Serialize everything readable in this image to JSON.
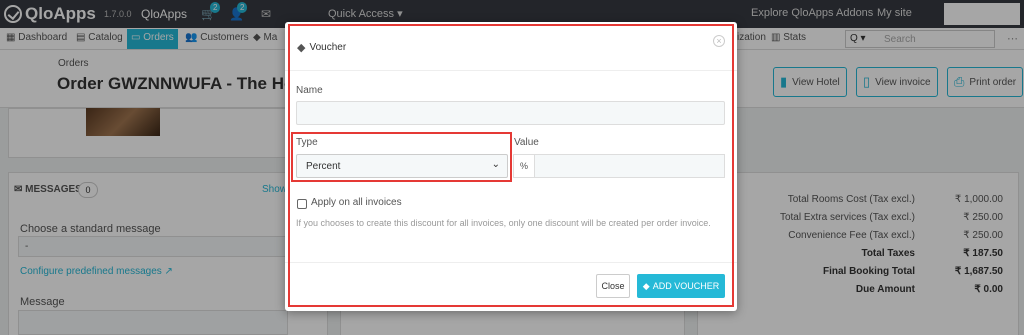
{
  "topbar": {
    "logo_text": "QloApps",
    "version": "1.7.0.0",
    "shop_name": "QloApps",
    "cart_badge": "2",
    "user_badge": "2",
    "quick_access": "Quick Access ▾",
    "explore": "Explore QloApps Addons",
    "my_site": "My site"
  },
  "nav": {
    "items": [
      "Dashboard",
      "Catalog",
      "Orders",
      "Customers",
      "Ma",
      "ization",
      "Stats"
    ],
    "search_scope": "Q ▾",
    "search_placeholder": "Search"
  },
  "header": {
    "breadcrumb": "Orders",
    "title": "Order GWZNNWUFA - The Hotel P",
    "buttons": [
      "View Hotel",
      "View invoice",
      "Print order"
    ]
  },
  "messages": {
    "heading": "MESSAGES",
    "count": "0",
    "show_link": "Show",
    "std_label": "Choose a standard message",
    "std_value": "-",
    "configure_link": "Configure predefined messages",
    "message_label": "Message"
  },
  "totals": [
    {
      "label": "Total Rooms Cost (Tax excl.)",
      "value": "₹ 1,000.00",
      "bold": false
    },
    {
      "label": "Total Extra services (Tax excl.)",
      "value": "₹ 250.00",
      "bold": false
    },
    {
      "label": "Convenience Fee (Tax excl.)",
      "value": "₹ 250.00",
      "bold": false
    },
    {
      "label": "Total Taxes",
      "value": "₹ 187.50",
      "bold": true
    },
    {
      "label": "Final Booking Total",
      "value": "₹ 1,687.50",
      "bold": true
    },
    {
      "label": "Due Amount",
      "value": "₹ 0.00",
      "bold": true
    }
  ],
  "modal": {
    "title": "Voucher",
    "name_label": "Name",
    "name_value": "",
    "type_label": "Type",
    "type_value": "Percent",
    "value_label": "Value",
    "value_addon": "%",
    "value_value": "",
    "checkbox_label": "Apply on all invoices",
    "help_text": "If you chooses to create this discount for all invoices, only one discount will be created per order invoice.",
    "close_label": "Close",
    "add_label": "ADD VOUCHER"
  },
  "colors": {
    "accent": "#25b9d7",
    "topbar": "#363a41",
    "highlight": "#e53935"
  }
}
